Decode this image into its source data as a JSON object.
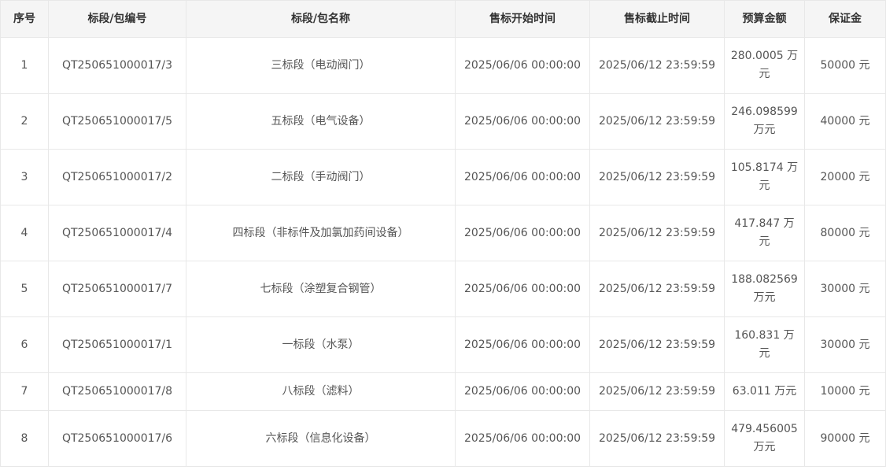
{
  "table": {
    "headers": [
      "序号",
      "标段/包编号",
      "标段/包名称",
      "售标开始时间",
      "售标截止时间",
      "预算金额",
      "保证金"
    ],
    "rows": [
      {
        "no": "1",
        "code": "QT250651000017/3",
        "name": "三标段（电动阀门）",
        "start": "2025/06/06 00:00:00",
        "end": "2025/06/12 23:59:59",
        "budget": "280.0005 万元",
        "deposit": "50000 元"
      },
      {
        "no": "2",
        "code": "QT250651000017/5",
        "name": "五标段（电气设备）",
        "start": "2025/06/06 00:00:00",
        "end": "2025/06/12 23:59:59",
        "budget": "246.098599 万元",
        "deposit": "40000 元"
      },
      {
        "no": "3",
        "code": "QT250651000017/2",
        "name": "二标段（手动阀门）",
        "start": "2025/06/06 00:00:00",
        "end": "2025/06/12 23:59:59",
        "budget": "105.8174 万元",
        "deposit": "20000 元"
      },
      {
        "no": "4",
        "code": "QT250651000017/4",
        "name": "四标段（非标件及加氯加药间设备）",
        "start": "2025/06/06 00:00:00",
        "end": "2025/06/12 23:59:59",
        "budget": "417.847 万元",
        "deposit": "80000 元"
      },
      {
        "no": "5",
        "code": "QT250651000017/7",
        "name": "七标段（涂塑复合钢管）",
        "start": "2025/06/06 00:00:00",
        "end": "2025/06/12 23:59:59",
        "budget": "188.082569 万元",
        "deposit": "30000 元"
      },
      {
        "no": "6",
        "code": "QT250651000017/1",
        "name": "一标段（水泵）",
        "start": "2025/06/06 00:00:00",
        "end": "2025/06/12 23:59:59",
        "budget": "160.831 万元",
        "deposit": "30000 元"
      },
      {
        "no": "7",
        "code": "QT250651000017/8",
        "name": "八标段（滤料）",
        "start": "2025/06/06 00:00:00",
        "end": "2025/06/12 23:59:59",
        "budget": "63.011 万元",
        "deposit": "10000 元"
      },
      {
        "no": "8",
        "code": "QT250651000017/6",
        "name": "六标段（信息化设备）",
        "start": "2025/06/06 00:00:00",
        "end": "2025/06/12 23:59:59",
        "budget": "479.456005 万元",
        "deposit": "90000 元"
      }
    ]
  }
}
